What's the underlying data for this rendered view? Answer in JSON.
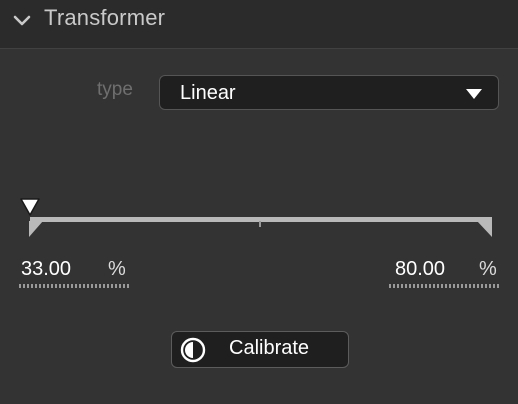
{
  "panel": {
    "title": "Transformer",
    "collapse_icon": "chevron-down-icon"
  },
  "type_field": {
    "label": "type",
    "value": "Linear",
    "caret_icon": "caret-down-icon"
  },
  "range": {
    "min_value": "33.00",
    "min_unit": "%",
    "max_value": "80.00",
    "max_unit": "%"
  },
  "calibrate": {
    "label": "Calibrate",
    "icon": "contrast-icon"
  },
  "colors": {
    "background": "#333333",
    "header": "#2b2b2b",
    "field": "#1f1f1f",
    "track": "#b9b9b9"
  }
}
